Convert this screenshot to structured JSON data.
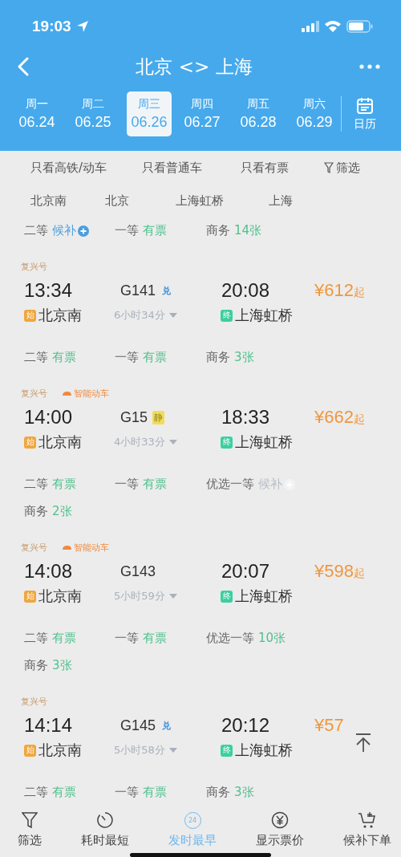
{
  "status_bar": {
    "time": "19:03"
  },
  "header": {
    "title": "北京 <> 上海"
  },
  "dates": [
    {
      "weekday": "周一",
      "date": "06.24",
      "selected": false
    },
    {
      "weekday": "周二",
      "date": "06.25",
      "selected": false
    },
    {
      "weekday": "周三",
      "date": "06.26",
      "selected": true
    },
    {
      "weekday": "周四",
      "date": "06.27",
      "selected": false
    },
    {
      "weekday": "周五",
      "date": "06.28",
      "selected": false
    },
    {
      "weekday": "周六",
      "date": "06.29",
      "selected": false
    }
  ],
  "calendar_button": {
    "label": "日历"
  },
  "quick_filters": [
    "只看高铁/动车",
    "只看普通车",
    "只看有票"
  ],
  "filter_button": {
    "label": "筛选"
  },
  "stations": [
    "北京南",
    "北京",
    "上海虹桥",
    "上海"
  ],
  "partial_seats": [
    {
      "class": "二等",
      "status": "候补",
      "kind": "waitlist"
    },
    {
      "class": "一等",
      "status": "有票",
      "kind": "available"
    },
    {
      "class": "商务",
      "status": "14张",
      "kind": "available"
    }
  ],
  "trains": [
    {
      "brand": "复兴号",
      "depart": "13:34",
      "number": "G141",
      "tag": {
        "text": "兑",
        "kind": "exchange"
      },
      "arrive": "20:08",
      "price": "¥612",
      "price_suffix": "起",
      "origin_badge": "始",
      "origin": "北京南",
      "duration": "6小时34分",
      "dest_badge": "终",
      "dest": "上海虹桥",
      "seats": [
        {
          "class": "二等",
          "status": "有票",
          "kind": "available"
        },
        {
          "class": "一等",
          "status": "有票",
          "kind": "available"
        },
        {
          "class": "商务",
          "status": "3张",
          "kind": "available"
        }
      ]
    },
    {
      "brand": "复兴号",
      "smart": "智能动车",
      "depart": "14:00",
      "number": "G15",
      "tag": {
        "text": "静",
        "kind": "quiet"
      },
      "arrive": "18:33",
      "price": "¥662",
      "price_suffix": "起",
      "origin_badge": "始",
      "origin": "北京南",
      "duration": "4小时33分",
      "dest_badge": "终",
      "dest": "上海虹桥",
      "seats": [
        {
          "class": "二等",
          "status": "有票",
          "kind": "available"
        },
        {
          "class": "一等",
          "status": "有票",
          "kind": "available"
        },
        {
          "class": "优选一等",
          "status": "候补",
          "kind": "waitlist_off"
        },
        {
          "class": "商务",
          "status": "2张",
          "kind": "available"
        }
      ]
    },
    {
      "brand": "复兴号",
      "smart": "智能动车",
      "depart": "14:08",
      "number": "G143",
      "arrive": "20:07",
      "price": "¥598",
      "price_suffix": "起",
      "origin_badge": "始",
      "origin": "北京南",
      "duration": "5小时59分",
      "dest_badge": "终",
      "dest": "上海虹桥",
      "seats": [
        {
          "class": "二等",
          "status": "有票",
          "kind": "available"
        },
        {
          "class": "一等",
          "status": "有票",
          "kind": "available"
        },
        {
          "class": "优选一等",
          "status": "10张",
          "kind": "available"
        },
        {
          "class": "商务",
          "status": "3张",
          "kind": "available"
        }
      ]
    },
    {
      "brand": "复兴号",
      "depart": "14:14",
      "number": "G145",
      "tag": {
        "text": "兑",
        "kind": "exchange"
      },
      "arrive": "20:12",
      "price": "¥57",
      "origin_badge": "始",
      "origin": "北京南",
      "duration": "5小时58分",
      "dest_badge": "终",
      "dest": "上海虹桥",
      "seats": [
        {
          "class": "二等",
          "status": "有票",
          "kind": "available"
        },
        {
          "class": "一等",
          "status": "有票",
          "kind": "available"
        },
        {
          "class": "商务",
          "status": "3张",
          "kind": "available"
        }
      ]
    }
  ],
  "bottom_nav": [
    {
      "label": "筛选",
      "kind": "filter",
      "selected": false
    },
    {
      "label": "耗时最短",
      "kind": "duration",
      "selected": false
    },
    {
      "label": "发时最早",
      "kind": "departure",
      "icon_text": "24",
      "selected": true
    },
    {
      "label": "显示票价",
      "kind": "price",
      "selected": false
    },
    {
      "label": "候补下单",
      "kind": "waitlist",
      "selected": false
    }
  ]
}
